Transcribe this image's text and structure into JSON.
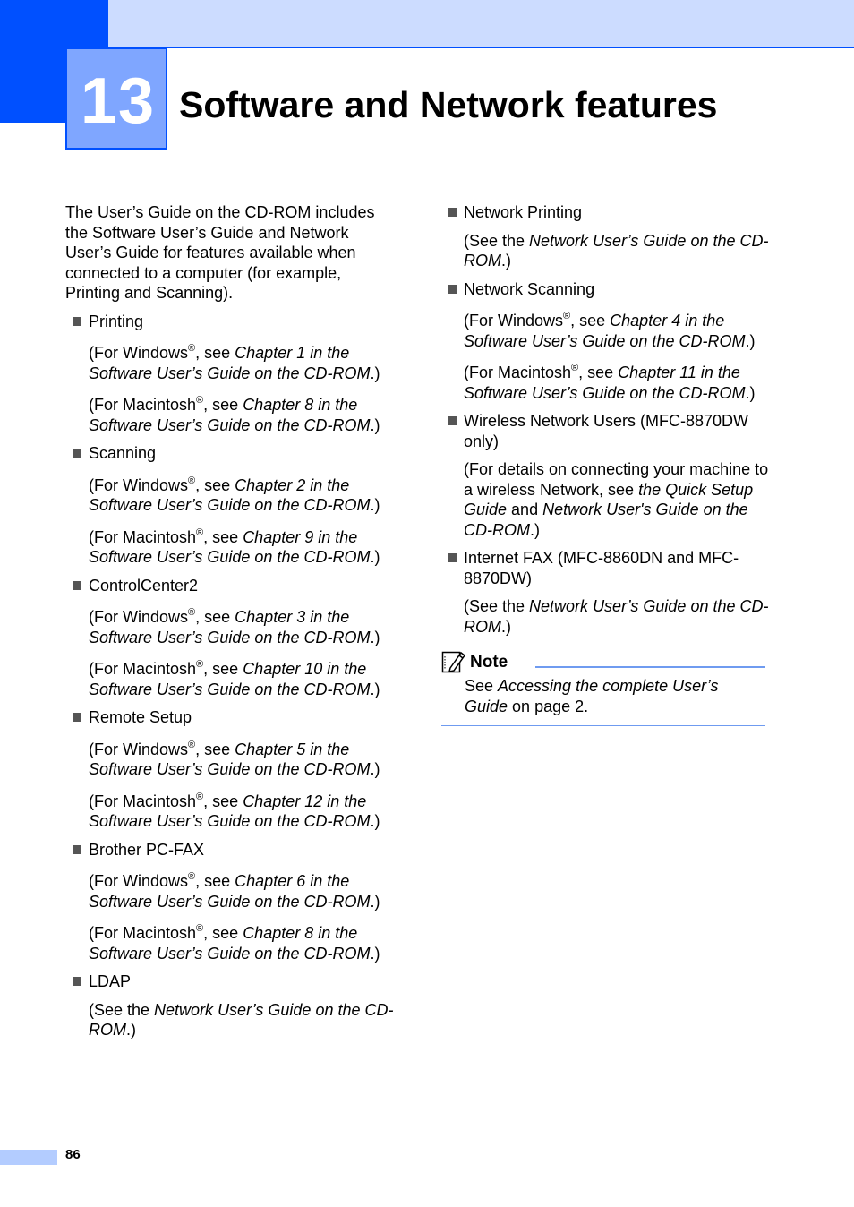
{
  "header": {
    "chapter_number": "13",
    "chapter_title": "Software and Network features",
    "colors": {
      "primary": "#0050ff",
      "light": "#ccdcff",
      "chapter_box": "#7fa6ff"
    }
  },
  "intro": "The User’s Guide on the CD-ROM includes the Software User’s Guide and Network User’s Guide for features available when connected to a computer (for example, Printing and Scanning).",
  "left_items": [
    {
      "label": "Printing",
      "win_ch": "Chapter 1 in the",
      "mac_ch": "Chapter 8 in the"
    },
    {
      "label": "Scanning",
      "win_ch": "Chapter 2 in the",
      "mac_ch": "Chapter 9 in the"
    },
    {
      "label": "ControlCenter2",
      "win_ch": "Chapter 3 in the",
      "mac_ch": "Chapter 10 in the"
    },
    {
      "label": "Remote Setup",
      "win_ch": "Chapter 5 in the",
      "mac_ch": "Chapter 12 in the"
    },
    {
      "label": "Brother PC-FAX",
      "win_ch": "Chapter 6 in the",
      "mac_ch": "Chapter 8 in the"
    },
    {
      "label": "LDAP"
    }
  ],
  "phrases": {
    "for_windows": "(For Windows",
    "for_mac": "(For Macintosh",
    "reg": "®",
    "see": ", see ",
    "sw_guide": "Software User’s Guide on the CD-ROM",
    "close": ".)",
    "see_the": "(See the ",
    "net_guide": "Network User’s Guide on the CD-ROM"
  },
  "right_items": [
    {
      "label": "Network Printing"
    },
    {
      "label": "Network Scanning",
      "win_ch": "Chapter 4 in the",
      "mac_ch": "Chapter 11 in the"
    },
    {
      "label": "Wireless Network Users (MFC-8870DW only)",
      "detail_1": "(For details on connecting your machine to a wireless Network, see ",
      "detail_2": "the Quick Setup Guide",
      "detail_3": " and ",
      "detail_4": "Network User's Guide on the CD-ROM",
      "detail_5": ".)"
    },
    {
      "label": "Internet FAX (MFC-8860DN and MFC-8870DW)"
    }
  ],
  "note": {
    "label": "Note",
    "text_1": "See ",
    "text_2": "Accessing the complete User’s Guide",
    "text_3": " on page 2."
  },
  "footer": {
    "page_number": "86"
  }
}
